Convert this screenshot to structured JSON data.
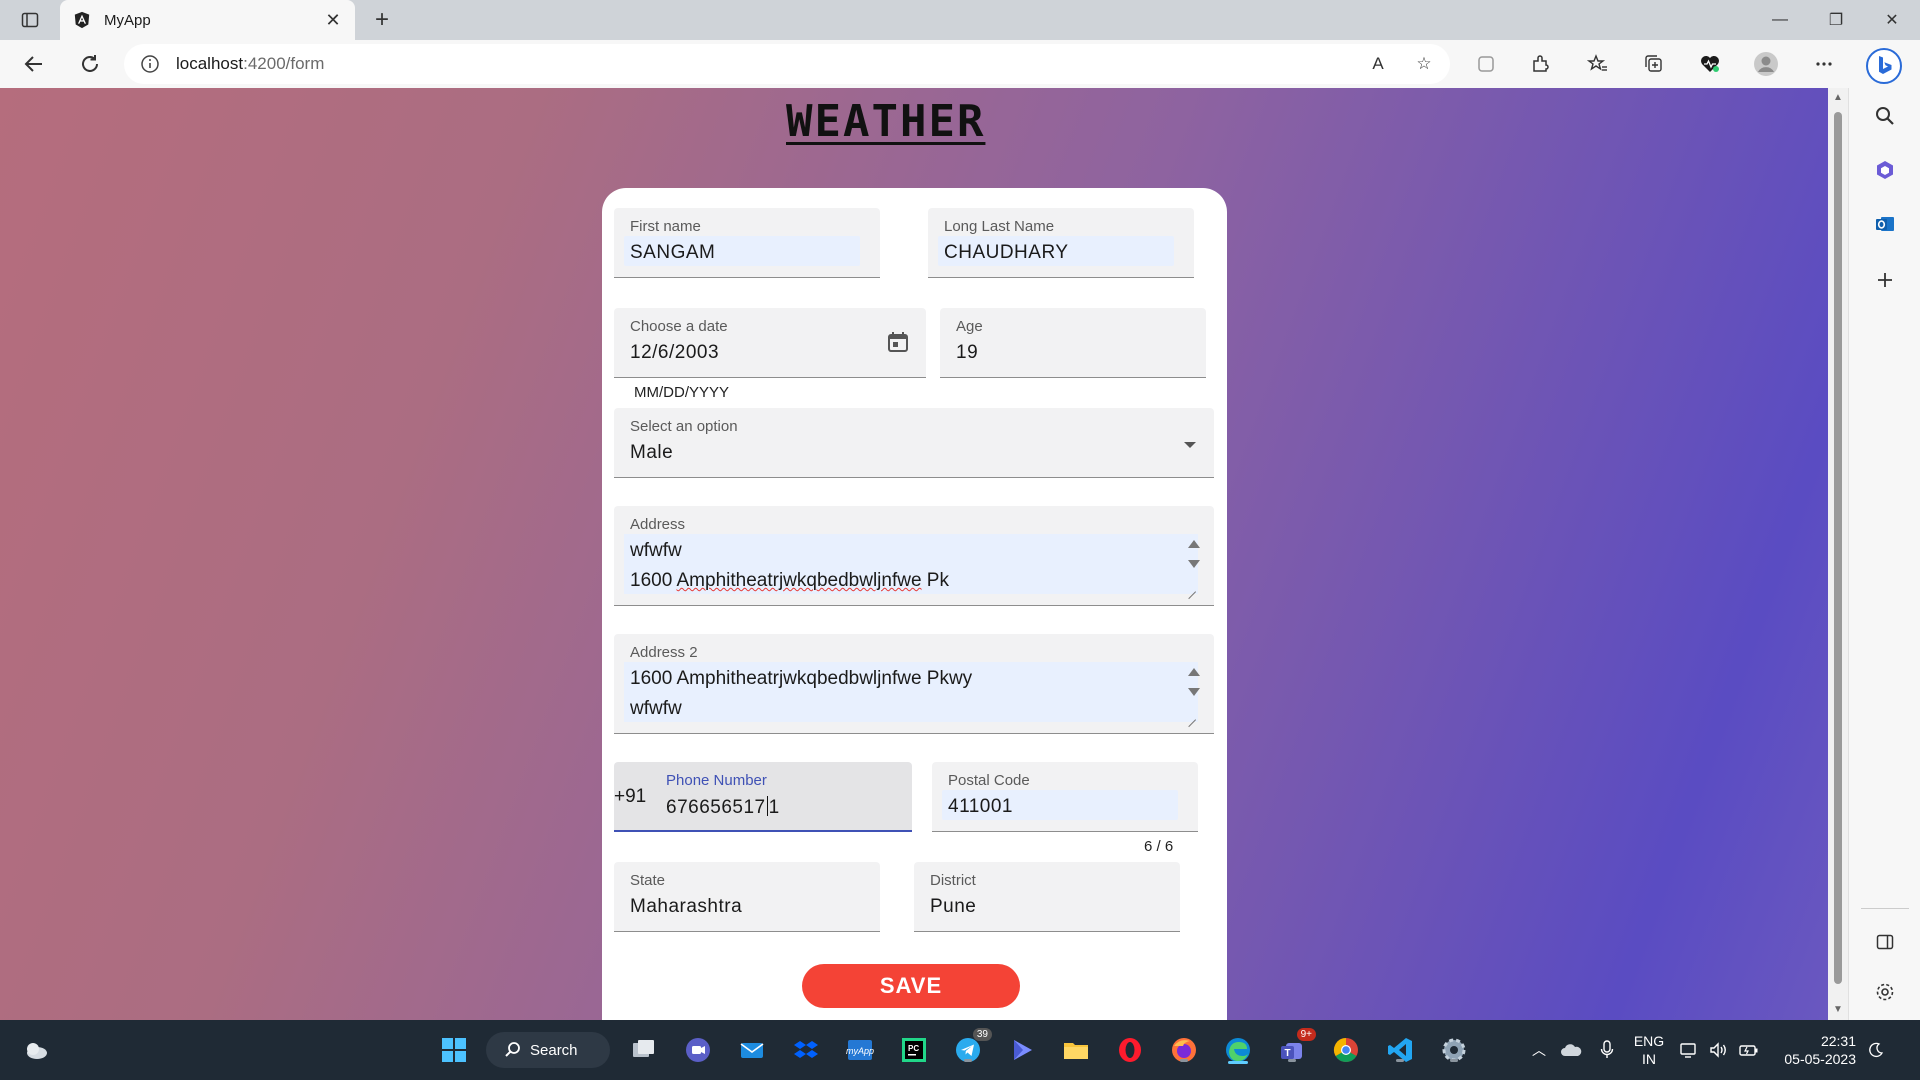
{
  "browser": {
    "tab_title": "MyApp",
    "tab_close": "✕",
    "new_tab": "+",
    "url_host": "localhost",
    "url_path": ":4200/form",
    "window": {
      "minimize": "—",
      "maximize": "❐",
      "close": "✕"
    }
  },
  "page": {
    "brand": "WEATHER",
    "form": {
      "first_name": {
        "label": "First name",
        "value": "SANGAM"
      },
      "last_name": {
        "label": "Long Last Name",
        "value": "CHAUDHARY"
      },
      "date": {
        "label": "Choose a date",
        "value": "12/6/2003",
        "hint": "MM/DD/YYYY"
      },
      "age": {
        "label": "Age",
        "value": "19"
      },
      "gender": {
        "label": "Select an option",
        "value": "Male"
      },
      "address": {
        "label": "Address",
        "line1": "wfwfw",
        "line2_plain": "1600 ",
        "line2_misspelled": "Amphitheatrjwkqbedbwljnfwe",
        "line2_tail": " Pk"
      },
      "address2": {
        "label": "Address 2",
        "line1": "1600 Amphitheatrjwkqbedbwljnfwe Pkwy",
        "line2": "wfwfw"
      },
      "phone": {
        "prefix": "+91",
        "label": "Phone Number",
        "value_before_caret": "676656517",
        "value_after_caret": "1"
      },
      "postal": {
        "label": "Postal Code",
        "value": "411001",
        "counter": "6 / 6"
      },
      "state": {
        "label": "State",
        "value": "Maharashtra"
      },
      "district": {
        "label": "District",
        "value": "Pune"
      },
      "save_label": "SAVE"
    }
  },
  "taskbar": {
    "search_label": "Search",
    "telegram_badge": "39",
    "teams_badge": "9+",
    "lang_line1": "ENG",
    "lang_line2": "IN",
    "time": "22:31",
    "date": "05-05-2023"
  },
  "colors": {
    "accent": "#3f51b5",
    "save": "#f44336",
    "autofill": "#e8f0fe"
  }
}
